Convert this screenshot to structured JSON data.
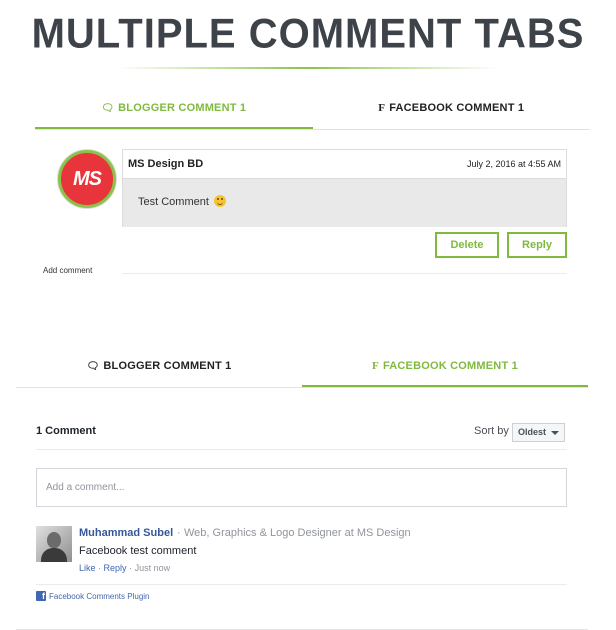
{
  "hero": {
    "title": "MULTIPLE COMMENT TABS"
  },
  "colors": {
    "accent": "#7fba3e",
    "facebook_blue": "#4267b2",
    "ms_red": "#e8343b"
  },
  "tabs_top": {
    "blogger_label": "BLOGGER COMMENT 1",
    "facebook_label": "FACEBOOK COMMENT 1",
    "active": "blogger"
  },
  "blogger": {
    "avatar_text": "MS",
    "author": "MS Design BD",
    "date": "July 2, 2016 at 4:55 AM",
    "text": "Test Comment",
    "delete_label": "Delete",
    "reply_label": "Reply",
    "add_comment": "Add comment"
  },
  "tabs_bottom": {
    "blogger_label": "BLOGGER COMMENT 1",
    "facebook_label": "FACEBOOK COMMENT 1",
    "active": "facebook"
  },
  "facebook": {
    "count": "1 Comment",
    "sort_label": "Sort by",
    "sort_value": "Oldest",
    "input_placeholder": "Add a comment...",
    "comment": {
      "author": "Muhammad Subel",
      "separator": "·",
      "author_title": "Web, Graphics & Logo Designer at MS Design",
      "text": "Facebook test comment",
      "like": "Like",
      "reply": "Reply",
      "time": "Just now"
    },
    "plugin_label": "Facebook Comments Plugin"
  },
  "icons": [
    "comments-icon",
    "facebook-f-icon",
    "smiley-emoji-icon",
    "chevron-down-icon",
    "facebook-square-icon"
  ]
}
